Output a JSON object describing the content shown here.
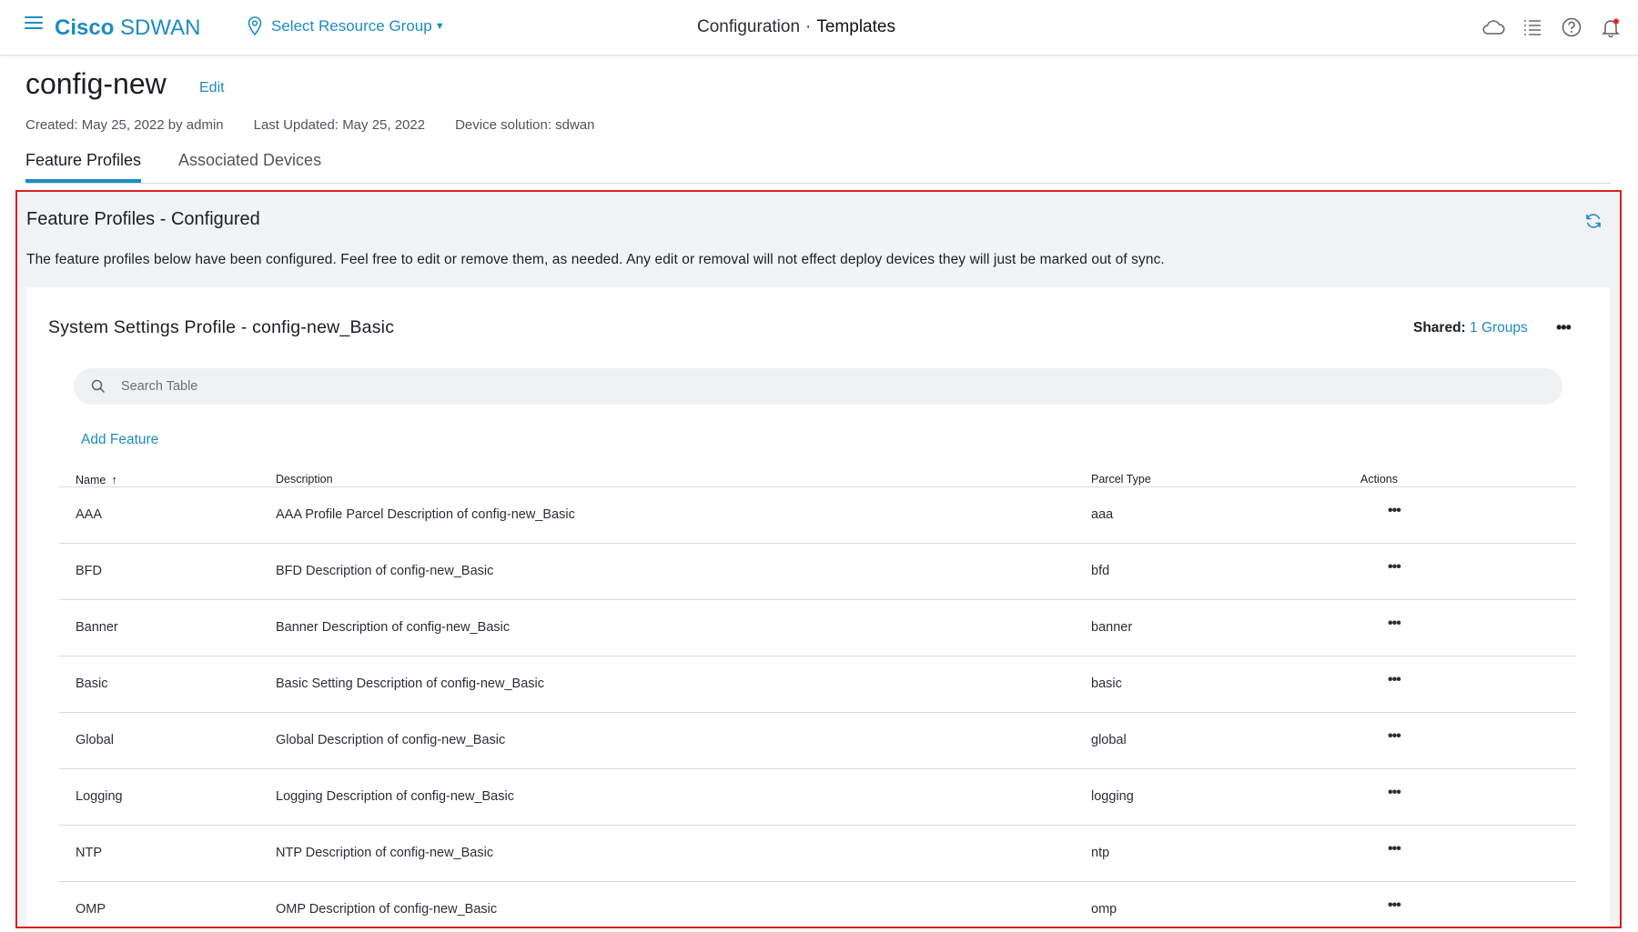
{
  "header": {
    "brand_bold": "Cisco",
    "brand_light": "SDWAN",
    "resource_group": "Select Resource Group",
    "breadcrumb_parent": "Configuration",
    "breadcrumb_sep": "·",
    "breadcrumb_current": "Templates",
    "icons": [
      "hamburger-menu-icon",
      "location-pin-icon",
      "cloud-icon",
      "task-list-icon",
      "help-icon",
      "notification-bell-icon"
    ],
    "accent_color": "#1d8bc4"
  },
  "page": {
    "title": "config-new",
    "edit_label": "Edit",
    "created": "Created: May 25, 2022 by admin",
    "updated": "Last Updated: May 25, 2022",
    "solution": "Device solution: sdwan"
  },
  "tabs": [
    {
      "label": "Feature Profiles",
      "active": true
    },
    {
      "label": "Associated Devices",
      "active": false
    }
  ],
  "panel": {
    "title": "Feature Profiles - Configured",
    "description": "The feature profiles below have been configured. Feel free to edit or remove them, as needed. Any edit or removal will not effect deploy devices they will just be marked out of sync.",
    "highlight_color": "#d92020"
  },
  "profile": {
    "title": "System Settings Profile - config-new_Basic",
    "shared_label": "Shared:",
    "shared_count": "1",
    "shared_unit": "Groups",
    "more_label": "•••",
    "search_placeholder": "Search Table",
    "add_feature_label": "Add Feature"
  },
  "table": {
    "columns": {
      "name": "Name",
      "description": "Description",
      "parcel_type": "Parcel Type",
      "actions": "Actions"
    },
    "sort_indicator": "↑",
    "action_label": "•••",
    "rows": [
      {
        "name": "AAA",
        "description": "AAA Profile Parcel Description of config-new_Basic",
        "parcel_type": "aaa"
      },
      {
        "name": "BFD",
        "description": "BFD Description of config-new_Basic",
        "parcel_type": "bfd"
      },
      {
        "name": "Banner",
        "description": "Banner Description of config-new_Basic",
        "parcel_type": "banner"
      },
      {
        "name": "Basic",
        "description": "Basic Setting Description of config-new_Basic",
        "parcel_type": "basic"
      },
      {
        "name": "Global",
        "description": "Global Description of config-new_Basic",
        "parcel_type": "global"
      },
      {
        "name": "Logging",
        "description": "Logging Description of config-new_Basic",
        "parcel_type": "logging"
      },
      {
        "name": "NTP",
        "description": "NTP Description of config-new_Basic",
        "parcel_type": "ntp"
      },
      {
        "name": "OMP",
        "description": "OMP Description of config-new_Basic",
        "parcel_type": "omp"
      }
    ]
  }
}
